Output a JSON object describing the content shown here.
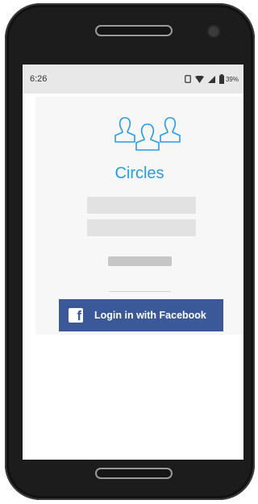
{
  "status_bar": {
    "time": "6:26",
    "battery_percent": "39%",
    "icons": [
      "sim-icon",
      "wifi-icon",
      "signal-icon",
      "battery-icon"
    ]
  },
  "app": {
    "title": "Circles",
    "logo_icon": "people-group-icon",
    "accent_color": "#2a9be0"
  },
  "login_form": {
    "username_placeholder": "",
    "password_placeholder": "",
    "submit_label": ""
  },
  "facebook": {
    "button_label": "Login in with Facebook",
    "icon": "facebook-icon",
    "icon_glyph": "f",
    "brand_color": "#3b5998"
  }
}
